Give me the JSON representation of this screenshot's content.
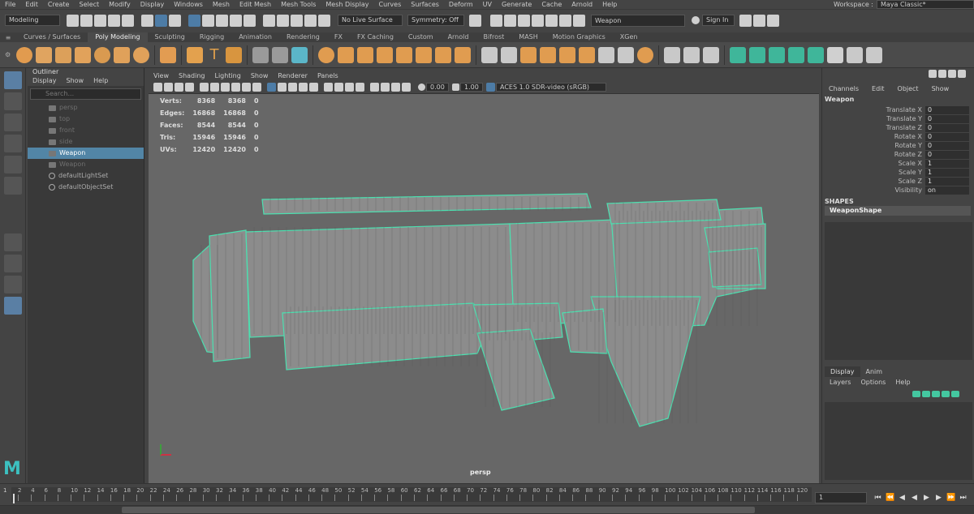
{
  "menubar": {
    "items": [
      "File",
      "Edit",
      "Create",
      "Select",
      "Modify",
      "Display",
      "Windows",
      "Mesh",
      "Edit Mesh",
      "Mesh Tools",
      "Mesh Display",
      "Curves",
      "Surfaces",
      "Deform",
      "UV",
      "Generate",
      "Cache",
      "Arnold",
      "Help"
    ],
    "workspace_label": "Workspace :",
    "workspace_value": "Maya Classic*"
  },
  "statusline": {
    "mode": "Modeling",
    "live_surface": "No Live Surface",
    "symmetry": "Symmetry: Off",
    "name_field": "Weapon",
    "sign_in": "Sign In"
  },
  "shelf": {
    "tabs": [
      "Curves / Surfaces",
      "Poly Modeling",
      "Sculpting",
      "Rigging",
      "Animation",
      "Rendering",
      "FX",
      "FX Caching",
      "Custom",
      "Arnold",
      "Bifrost",
      "MASH",
      "Motion Graphics",
      "XGen"
    ],
    "active_tab": "Poly Modeling"
  },
  "outliner": {
    "title": "Outliner",
    "menu": [
      "Display",
      "Show",
      "Help"
    ],
    "search_placeholder": "Search...",
    "items": [
      {
        "label": "persp",
        "state": "dim"
      },
      {
        "label": "top",
        "state": "dim"
      },
      {
        "label": "front",
        "state": "dim"
      },
      {
        "label": "side",
        "state": "dim"
      },
      {
        "label": "Weapon",
        "state": "sel"
      },
      {
        "label": "Weapon",
        "state": "dim"
      },
      {
        "label": "defaultLightSet",
        "state": "set"
      },
      {
        "label": "defaultObjectSet",
        "state": "set"
      }
    ]
  },
  "viewport": {
    "menu": [
      "View",
      "Shading",
      "Lighting",
      "Show",
      "Renderer",
      "Panels"
    ],
    "exposure": "0.00",
    "gamma": "1.00",
    "color_space": "ACES 1.0 SDR-video (sRGB)",
    "camera": "persp",
    "hud": [
      {
        "label": "Verts:",
        "a": "8368",
        "b": "8368",
        "c": "0"
      },
      {
        "label": "Edges:",
        "a": "16868",
        "b": "16868",
        "c": "0"
      },
      {
        "label": "Faces:",
        "a": "8544",
        "b": "8544",
        "c": "0"
      },
      {
        "label": "Tris:",
        "a": "15946",
        "b": "15946",
        "c": "0"
      },
      {
        "label": "UVs:",
        "a": "12420",
        "b": "12420",
        "c": "0"
      }
    ],
    "wire_color": "#4ce0b0"
  },
  "channelbox": {
    "menu": [
      "Channels",
      "Edit",
      "Object",
      "Show"
    ],
    "object": "Weapon",
    "channels": [
      {
        "label": "Translate X",
        "value": "0"
      },
      {
        "label": "Translate Y",
        "value": "0"
      },
      {
        "label": "Translate Z",
        "value": "0"
      },
      {
        "label": "Rotate X",
        "value": "0"
      },
      {
        "label": "Rotate Y",
        "value": "0"
      },
      {
        "label": "Rotate Z",
        "value": "0"
      },
      {
        "label": "Scale X",
        "value": "1"
      },
      {
        "label": "Scale Y",
        "value": "1"
      },
      {
        "label": "Scale Z",
        "value": "1"
      },
      {
        "label": "Visibility",
        "value": "on"
      }
    ],
    "shapes_header": "SHAPES",
    "shape_name": "WeaponShape",
    "layer_tabs": [
      "Display",
      "Anim"
    ],
    "layer_menu": [
      "Layers",
      "Options",
      "Help"
    ]
  },
  "timeline": {
    "ticks": [
      "2",
      "4",
      "6",
      "8",
      "10",
      "12",
      "14",
      "16",
      "18",
      "20",
      "22",
      "24",
      "26",
      "28",
      "30",
      "32",
      "34",
      "36",
      "38",
      "40",
      "42",
      "44",
      "46",
      "48",
      "50",
      "52",
      "54",
      "56",
      "58",
      "60",
      "62",
      "64",
      "66",
      "68",
      "70",
      "72",
      "74",
      "76",
      "78",
      "80",
      "82",
      "84",
      "86",
      "88",
      "90",
      "92",
      "94",
      "96",
      "98",
      "100",
      "102",
      "104",
      "106",
      "108",
      "110",
      "112",
      "114",
      "116",
      "118",
      "120"
    ],
    "current_frame": "1",
    "start": "1"
  },
  "logo": "M"
}
